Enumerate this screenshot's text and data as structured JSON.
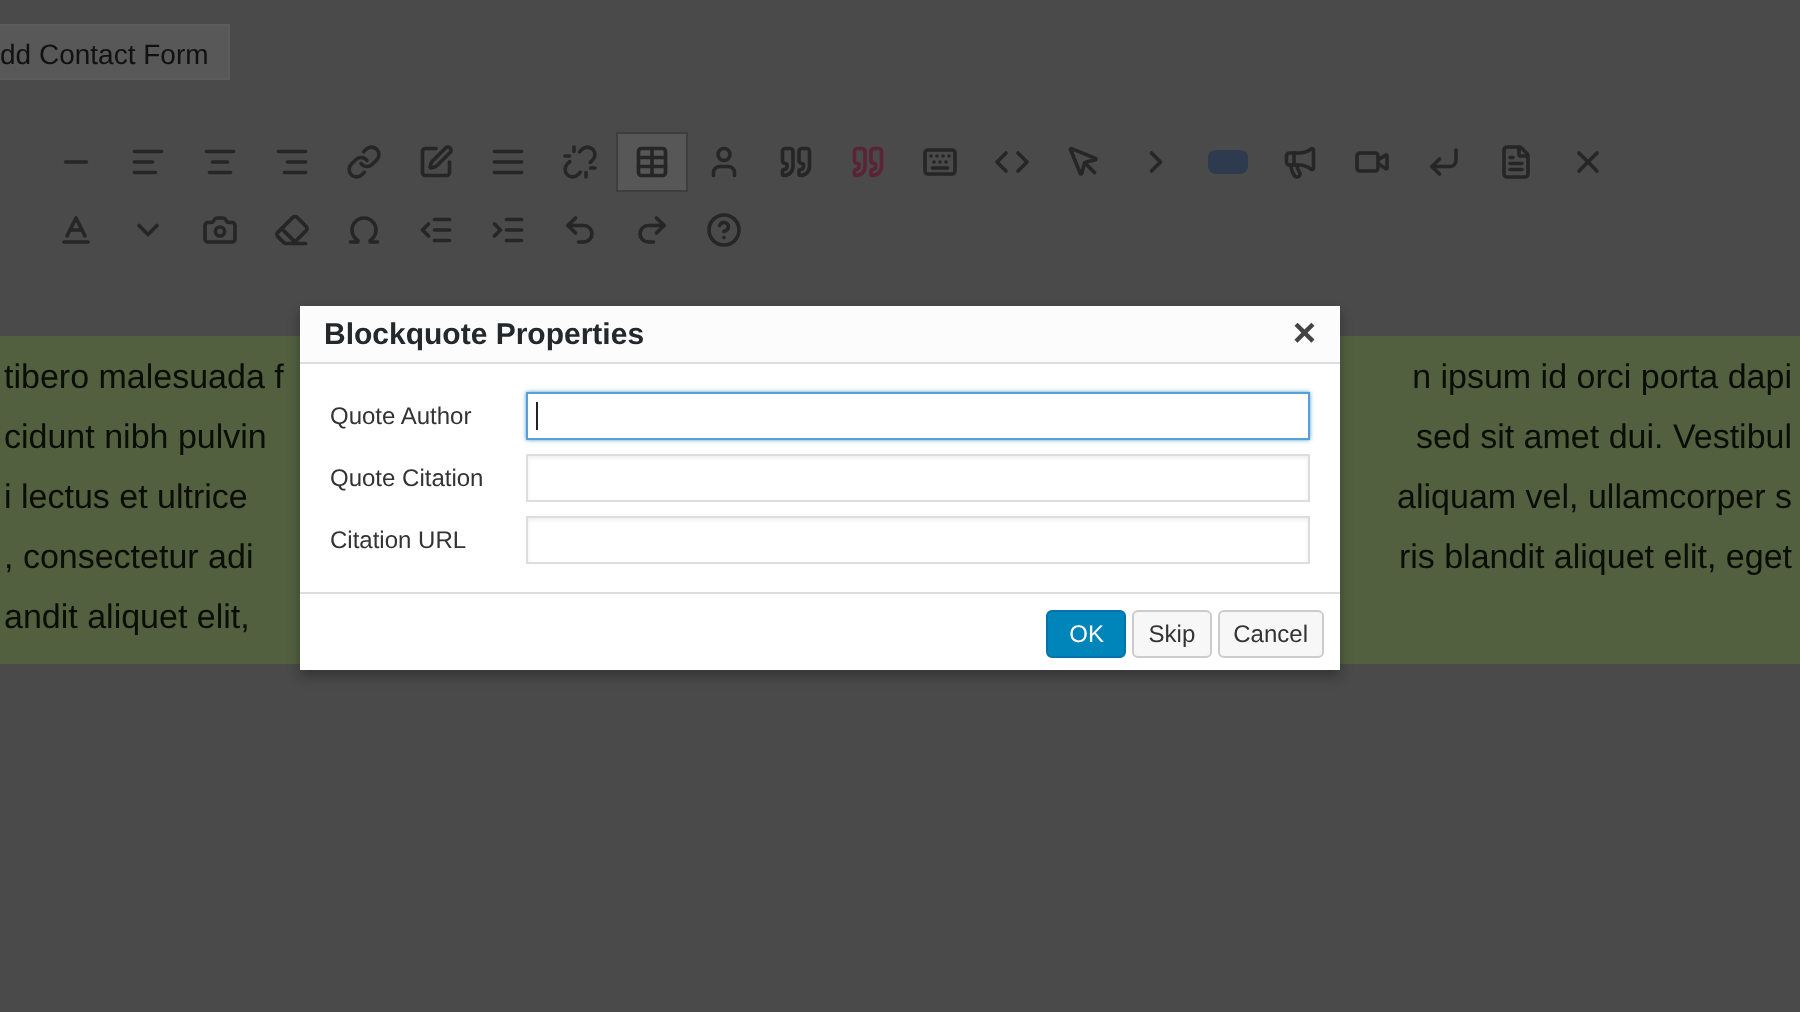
{
  "editor": {
    "add_form_button": "dd Contact Form",
    "text_lines": [
      {
        "left": "tibero malesuada f",
        "right": "n ipsum id orci porta dapi"
      },
      {
        "left": "cidunt nibh pulvin",
        "right": "sed sit amet dui. Vestibul"
      },
      {
        "left": "i lectus et ultrice",
        "right": "aliquam vel, ullamcorper s"
      },
      {
        "left": ", consectetur adi",
        "right": "ris blandit aliquet elit, eget"
      },
      {
        "left": "andit aliquet elit,"
      }
    ]
  },
  "dialog": {
    "title": "Blockquote Properties",
    "close": "×",
    "fields": [
      {
        "label": "Quote Author",
        "focused": true
      },
      {
        "label": "Quote Citation",
        "focused": false
      },
      {
        "label": "Citation URL",
        "focused": false
      }
    ],
    "buttons": [
      {
        "label": "OK",
        "kind": "primary"
      },
      {
        "label": "Skip",
        "kind": "secondary"
      },
      {
        "label": "Cancel",
        "kind": "secondary"
      }
    ]
  }
}
